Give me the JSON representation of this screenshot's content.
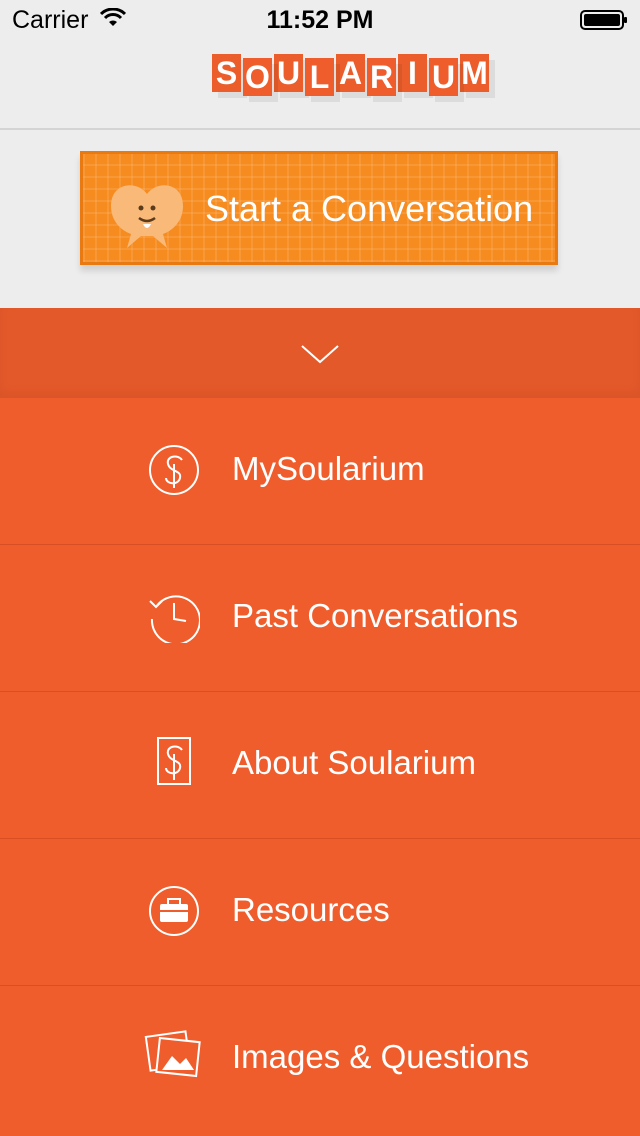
{
  "status_bar": {
    "carrier": "Carrier",
    "time": "11:52 PM"
  },
  "header": {
    "logo_letters": [
      "S",
      "O",
      "U",
      "L",
      "A",
      "R",
      "I",
      "U",
      "M"
    ]
  },
  "cta": {
    "label": "Start a Conversation"
  },
  "menu": {
    "items": [
      {
        "label": "MySoularium",
        "icon": "soularium-circle-icon"
      },
      {
        "label": "Past Conversations",
        "icon": "history-clock-icon"
      },
      {
        "label": "About Soularium",
        "icon": "soularium-card-icon"
      },
      {
        "label": "Resources",
        "icon": "briefcase-icon"
      },
      {
        "label": "Images & Questions",
        "icon": "images-icon"
      }
    ]
  },
  "colors": {
    "brand_orange": "#F05D2C",
    "cta_orange": "#F68B1F",
    "header_bg": "#EDEDED"
  }
}
